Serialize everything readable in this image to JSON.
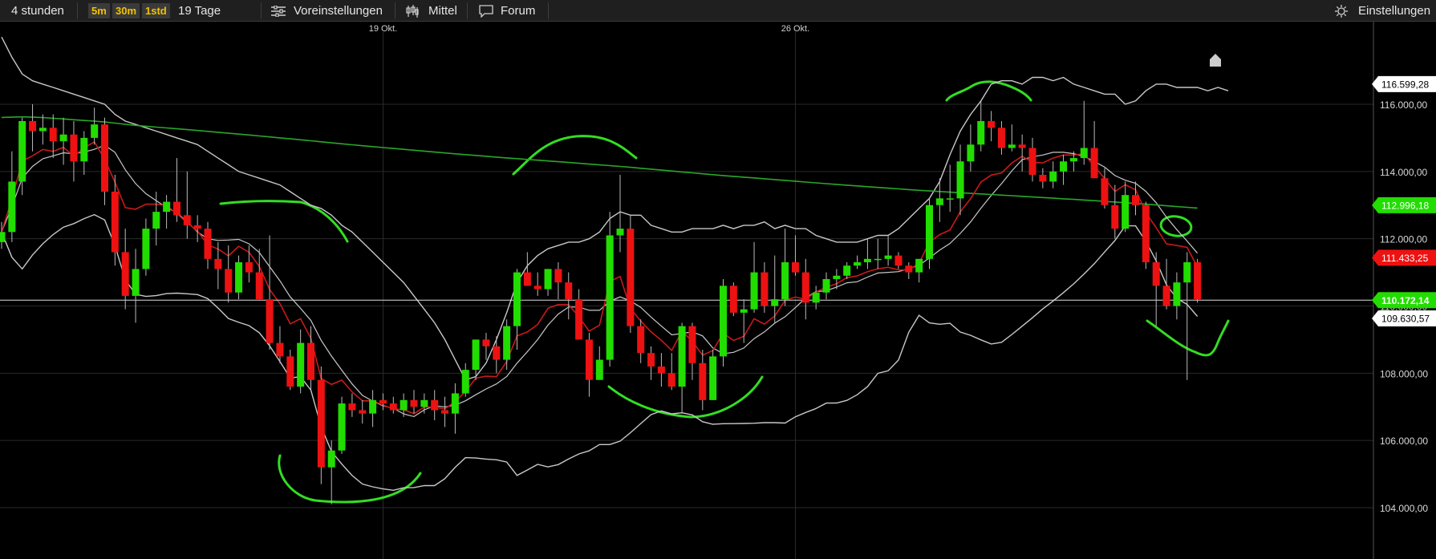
{
  "toolbar": {
    "interval": "4 stunden",
    "timeframes": [
      "5m",
      "30m",
      "1std"
    ],
    "period": "19 Tage",
    "presets_label": "Voreinstellungen",
    "average_label": "Mittel",
    "forum_label": "Forum",
    "settings_label": "Einstellungen",
    "icons": [
      "sliders-icon",
      "candlestick-icon",
      "chat-bubble-icon",
      "gear-icon"
    ]
  },
  "colors": {
    "background": "#000000",
    "up_candle": "#22dd00",
    "down_candle": "#ee1111",
    "ma_red": "#c81a1a",
    "ma_green": "#2aa62a",
    "bollinger": "#c8c8c8",
    "annotation": "#33dd22"
  },
  "chart_data": {
    "type": "candlestick",
    "x_labels": [
      {
        "label": "19 Okt.",
        "index": 37
      },
      {
        "label": "26 Okt.",
        "index": 77
      }
    ],
    "y_ticks": [
      104000,
      106000,
      108000,
      110000,
      112000,
      114000,
      116000
    ],
    "y_tick_labels": [
      "104.000,00",
      "106.000,00",
      "108.000,00",
      "110.000,00",
      "112.000,00",
      "114.000,00",
      "116.000,00"
    ],
    "ylim": [
      102800,
      117100
    ],
    "price_tags": [
      {
        "label": "116.599,28",
        "value": 116599.28,
        "style": "white"
      },
      {
        "label": "112.996,18",
        "value": 112996.18,
        "style": "green"
      },
      {
        "label": "111.433,25",
        "value": 111433.25,
        "style": "red"
      },
      {
        "label": "110.172,14",
        "value": 110172.14,
        "style": "green"
      },
      {
        "label": "109.630,57",
        "value": 109630.57,
        "style": "white"
      }
    ],
    "current_price": 110172.14,
    "candles": [
      [
        111900,
        112500,
        111700,
        112200
      ],
      [
        112200,
        114600,
        111900,
        113700
      ],
      [
        113700,
        115600,
        113300,
        115500
      ],
      [
        115500,
        116000,
        114600,
        115200
      ],
      [
        115200,
        115700,
        114800,
        115300
      ],
      [
        115300,
        115700,
        114400,
        114900
      ],
      [
        114900,
        115600,
        114200,
        115100
      ],
      [
        115100,
        115500,
        113700,
        114300
      ],
      [
        114300,
        115200,
        113900,
        115000
      ],
      [
        115000,
        115900,
        114800,
        115400
      ],
      [
        115400,
        115600,
        113000,
        113400
      ],
      [
        113400,
        113900,
        111200,
        111600
      ],
      [
        111600,
        112300,
        109900,
        110300
      ],
      [
        110300,
        111700,
        109500,
        111100
      ],
      [
        111100,
        112600,
        110900,
        112300
      ],
      [
        112300,
        113400,
        111800,
        112800
      ],
      [
        112800,
        113300,
        112300,
        113100
      ],
      [
        113100,
        114400,
        112500,
        112700
      ],
      [
        112700,
        114000,
        112000,
        112400
      ],
      [
        112400,
        112700,
        111900,
        112300
      ],
      [
        112300,
        112500,
        111100,
        111400
      ],
      [
        111400,
        111900,
        110500,
        111100
      ],
      [
        111100,
        111800,
        110100,
        110400
      ],
      [
        110400,
        111500,
        110200,
        111300
      ],
      [
        111300,
        111800,
        110700,
        111000
      ],
      [
        111000,
        111700,
        110200,
        110200
      ],
      [
        110200,
        112100,
        108700,
        108900
      ],
      [
        108900,
        109400,
        108300,
        108500
      ],
      [
        108500,
        108700,
        107500,
        107600
      ],
      [
        107600,
        109300,
        107400,
        108900
      ],
      [
        108900,
        109400,
        107500,
        107800
      ],
      [
        107800,
        108200,
        104700,
        105200
      ],
      [
        105200,
        106000,
        104100,
        105700
      ],
      [
        105700,
        107300,
        105600,
        107100
      ],
      [
        107100,
        107400,
        106700,
        106900
      ],
      [
        106900,
        107200,
        106500,
        106800
      ],
      [
        106800,
        107500,
        106400,
        107200
      ],
      [
        107200,
        107400,
        106900,
        107100
      ],
      [
        107100,
        107300,
        106800,
        106900
      ],
      [
        106900,
        107400,
        106700,
        107200
      ],
      [
        107200,
        107500,
        106800,
        107000
      ],
      [
        107000,
        107400,
        106800,
        107200
      ],
      [
        107200,
        107500,
        106600,
        106900
      ],
      [
        106900,
        107300,
        106400,
        106800
      ],
      [
        106800,
        107700,
        106200,
        107400
      ],
      [
        107400,
        108300,
        107300,
        108100
      ],
      [
        108100,
        109000,
        107800,
        109000
      ],
      [
        109000,
        109200,
        108400,
        108800
      ],
      [
        108800,
        109100,
        108000,
        108400
      ],
      [
        108400,
        109600,
        108100,
        109400
      ],
      [
        109400,
        111100,
        108700,
        111000
      ],
      [
        111000,
        111600,
        110600,
        110600
      ],
      [
        110600,
        111000,
        110300,
        110500
      ],
      [
        110500,
        111100,
        110300,
        111100
      ],
      [
        111100,
        111300,
        110200,
        110700
      ],
      [
        110700,
        111000,
        109600,
        110200
      ],
      [
        110200,
        110500,
        109000,
        109000
      ],
      [
        109000,
        109200,
        107300,
        107800
      ],
      [
        107800,
        108800,
        107800,
        108400
      ],
      [
        108400,
        112800,
        108200,
        112100
      ],
      [
        112100,
        113900,
        111600,
        112300
      ],
      [
        112300,
        112700,
        109200,
        109400
      ],
      [
        109400,
        109600,
        108300,
        108600
      ],
      [
        108600,
        108800,
        107800,
        108200
      ],
      [
        108200,
        108600,
        107600,
        108000
      ],
      [
        108000,
        108600,
        107500,
        107600
      ],
      [
        107600,
        109500,
        106800,
        109400
      ],
      [
        109400,
        109500,
        107800,
        108300
      ],
      [
        108300,
        108700,
        106900,
        107200
      ],
      [
        107200,
        108700,
        107200,
        108500
      ],
      [
        108500,
        110800,
        108200,
        110600
      ],
      [
        110600,
        110700,
        109700,
        109800
      ],
      [
        109800,
        110200,
        108900,
        109900
      ],
      [
        109900,
        111900,
        109800,
        111000
      ],
      [
        111000,
        111300,
        109800,
        110000
      ],
      [
        110000,
        111500,
        109500,
        110200
      ],
      [
        110200,
        112300,
        110000,
        111300
      ],
      [
        111300,
        112100,
        110900,
        111000
      ],
      [
        111000,
        111400,
        109600,
        110100
      ],
      [
        110100,
        110600,
        109900,
        110400
      ],
      [
        110400,
        111000,
        110200,
        110800
      ],
      [
        110800,
        111100,
        110500,
        110900
      ],
      [
        110900,
        111300,
        110800,
        111200
      ],
      [
        111200,
        111500,
        111100,
        111300
      ],
      [
        111300,
        112000,
        111100,
        111400
      ],
      [
        111400,
        112000,
        111100,
        111400
      ],
      [
        111400,
        112100,
        111200,
        111500
      ],
      [
        111500,
        111600,
        111100,
        111200
      ],
      [
        111200,
        111300,
        110800,
        111000
      ],
      [
        111000,
        111400,
        110700,
        111400
      ],
      [
        111400,
        113200,
        111100,
        113000
      ],
      [
        113000,
        113800,
        112500,
        113200
      ],
      [
        113200,
        114200,
        112800,
        113200
      ],
      [
        113200,
        114800,
        112700,
        114300
      ],
      [
        114300,
        115400,
        114000,
        114800
      ],
      [
        114800,
        116100,
        114600,
        115500
      ],
      [
        115500,
        115800,
        114900,
        115300
      ],
      [
        115300,
        115500,
        114500,
        114700
      ],
      [
        114700,
        115400,
        114600,
        114800
      ],
      [
        114800,
        115100,
        114000,
        114700
      ],
      [
        114700,
        115000,
        113700,
        113900
      ],
      [
        113900,
        114100,
        113500,
        113700
      ],
      [
        113700,
        114300,
        113500,
        114000
      ],
      [
        114000,
        114500,
        113600,
        114300
      ],
      [
        114300,
        114600,
        114000,
        114400
      ],
      [
        114400,
        116100,
        114200,
        114700
      ],
      [
        114700,
        115500,
        113900,
        113800
      ],
      [
        113800,
        114100,
        112900,
        113000
      ],
      [
        113000,
        113600,
        112000,
        112300
      ],
      [
        112300,
        113700,
        112200,
        113300
      ],
      [
        113300,
        113700,
        112700,
        113000
      ],
      [
        113000,
        113100,
        111100,
        111300
      ],
      [
        111300,
        111600,
        109400,
        110600
      ],
      [
        110600,
        111400,
        109900,
        110000
      ],
      [
        110000,
        111000,
        109600,
        110700
      ],
      [
        110700,
        111600,
        107800,
        111300
      ],
      [
        111300,
        111400,
        110100,
        110200
      ]
    ],
    "bollinger_upper": [
      118000,
      117400,
      116900,
      116700,
      116600,
      116500,
      116400,
      116300,
      116200,
      116100,
      116000,
      115700,
      115500,
      115400,
      115300,
      115200,
      115100,
      115000,
      114900,
      114800,
      114600,
      114400,
      114200,
      114000,
      113900,
      113800,
      113700,
      113600,
      113400,
      113200,
      113000,
      112900,
      112700,
      112400,
      112200,
      111900,
      111600,
      111300,
      111000,
      110700,
      110300,
      109900,
      109500,
      109000,
      108400,
      107800,
      107900,
      108300,
      109000,
      109800,
      110700,
      111200,
      111500,
      111700,
      111800,
      111900,
      111900,
      112000,
      112200,
      112600,
      112800,
      112700,
      112700,
      112400,
      112300,
      112200,
      112200,
      112300,
      112300,
      112300,
      112400,
      112300,
      112400,
      112400,
      112500,
      112300,
      112400,
      112300,
      112300,
      112100,
      112000,
      111900,
      111900,
      111900,
      112000,
      112100,
      112100,
      112300,
      112600,
      112900,
      113200,
      113700,
      114500,
      115200,
      115700,
      116100,
      116600,
      116700,
      116700,
      116600,
      116800,
      116800,
      116700,
      116800,
      116600,
      116500,
      116400,
      116300,
      116300,
      116000,
      116100,
      116400,
      116600,
      116600,
      116500,
      116500,
      116500,
      116400,
      116500,
      116400
    ]
  }
}
